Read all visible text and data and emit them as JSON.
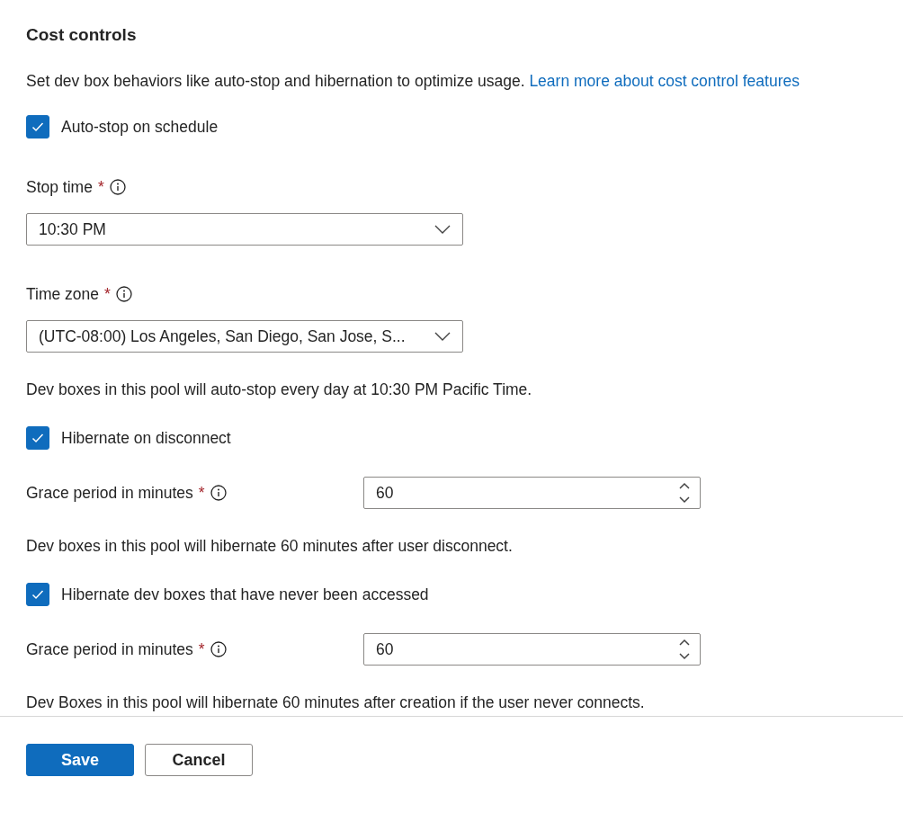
{
  "title": "Cost controls",
  "description": {
    "text": "Set dev box behaviors like auto-stop and hibernation to optimize usage.",
    "link": "Learn more about cost control features"
  },
  "items": [
    {
      "kind": "checkbox",
      "label": "Auto-stop on schedule",
      "checked": true
    },
    {
      "kind": "dropdown",
      "label": "Stop time",
      "required_mark": "*",
      "info": true,
      "value": "10:30 PM"
    },
    {
      "kind": "dropdown",
      "label": "Time zone",
      "required_mark": "*",
      "info": true,
      "value": "(UTC-08:00) Los Angeles, San Diego, San Jose, S..."
    },
    {
      "kind": "note",
      "text": "Dev boxes in this pool will auto-stop every day at 10:30 PM Pacific Time."
    },
    {
      "kind": "checkbox",
      "label": "Hibernate on disconnect",
      "checked": true
    },
    {
      "kind": "number",
      "label": "Grace period in minutes",
      "required_mark": "*",
      "info": true,
      "value": "60"
    },
    {
      "kind": "note",
      "text": "Dev boxes in this pool will hibernate 60 minutes after user disconnect."
    },
    {
      "kind": "checkbox",
      "label": "Hibernate dev boxes that have never been accessed",
      "checked": true
    },
    {
      "kind": "number",
      "label": "Grace period in minutes",
      "required_mark": "*",
      "info": true,
      "value": "60"
    },
    {
      "kind": "note",
      "text": "Dev Boxes in this pool will hibernate 60 minutes after creation if the user never connects."
    }
  ],
  "buttons": [
    {
      "label": "Save",
      "primary": true
    },
    {
      "label": "Cancel",
      "primary": false
    }
  ]
}
